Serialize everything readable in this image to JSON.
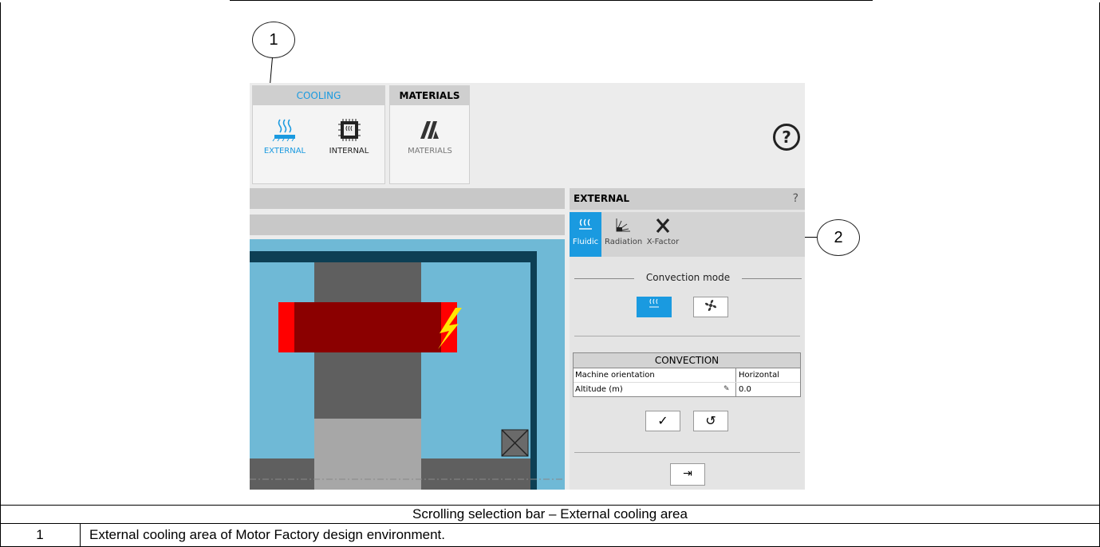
{
  "callouts": [
    "1",
    "2"
  ],
  "app": {
    "cooling_group": {
      "header": "COOLING",
      "tools": [
        {
          "label": "EXTERNAL",
          "icon": "external-cooling-icon",
          "active": true
        },
        {
          "label": "INTERNAL",
          "icon": "internal-cooling-icon",
          "active": false
        }
      ]
    },
    "materials_group": {
      "header": "MATERIALS",
      "tools": [
        {
          "label": "MATERIALS",
          "icon": "materials-icon"
        }
      ]
    },
    "help": "?",
    "panel": {
      "title": "EXTERNAL",
      "help": "?",
      "tabs": [
        {
          "label": "Fluidic",
          "icon": "fluidic-icon",
          "active": true
        },
        {
          "label": "Radiation",
          "icon": "radiation-icon",
          "active": false
        },
        {
          "label": "X-Factor",
          "icon": "x-factor-icon",
          "active": false
        }
      ],
      "convection_mode_label": "Convection mode",
      "convection_modes": [
        {
          "icon": "natural-convection-icon",
          "active": true
        },
        {
          "icon": "fan-icon",
          "active": false
        }
      ],
      "convection_table": {
        "header": "CONVECTION",
        "rows": [
          {
            "key": "Machine orientation",
            "value": "Horizontal"
          },
          {
            "key": "Altitude (m)",
            "value": "0.0"
          }
        ]
      },
      "actions": {
        "apply": "✓",
        "reset": "↺",
        "export": "⇥"
      }
    }
  },
  "caption": "Scrolling selection bar – External cooling area",
  "legend_rows": [
    {
      "num": "1",
      "text": "External cooling area of Motor Factory design environment."
    }
  ],
  "colors": {
    "accent": "#1a9ae0",
    "stator": "#8b0000",
    "coil": "#ff0000",
    "housing": "#0d3f54",
    "fluid": "#6fb9d6"
  }
}
